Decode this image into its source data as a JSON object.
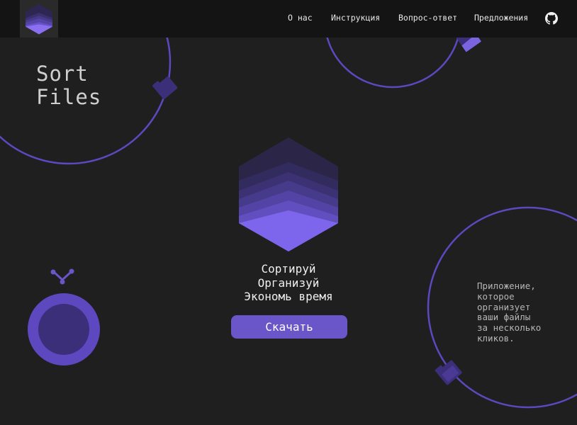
{
  "nav": {
    "logo_icon": "cube-logo-icon",
    "items": [
      {
        "label": "О нас"
      },
      {
        "label": "Инструкция"
      },
      {
        "label": "Вопрос-ответ"
      },
      {
        "label": "Предложения"
      }
    ],
    "github_icon": "github-icon"
  },
  "brand": {
    "line1": "Sort",
    "line2": "Files"
  },
  "hero": {
    "logo_icon": "layered-hexagon-icon",
    "tagline": [
      "Сортируй",
      "Организуй",
      "Экономь время"
    ],
    "button_label": "Скачать"
  },
  "description": {
    "lines": [
      "Приложение,",
      "которое",
      "организует",
      "ваши файлы",
      "за несколько",
      "кликов."
    ]
  },
  "decor": {
    "icons": [
      "folder-icon",
      "folder-icon",
      "folder-icon",
      "git-branch-icon"
    ]
  },
  "colors": {
    "background": "#1f1f1f",
    "header": "#141414",
    "accent": "#6a55c9",
    "ring": "#5d48c0",
    "text": "#e8e8e8"
  }
}
